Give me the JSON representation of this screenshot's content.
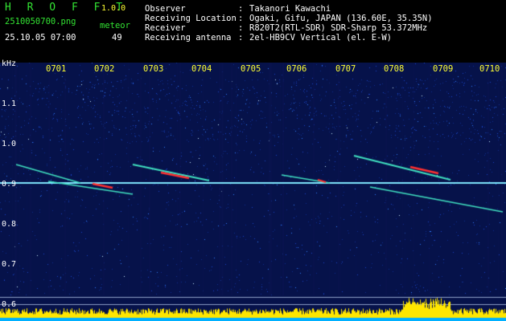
{
  "header": {
    "app_name": "H R O F F T",
    "version": "1.0.0",
    "filename": "2510050700.png",
    "datetime": "25.10.05 07:00",
    "meteor_label": "meteor",
    "meteor_count": "49",
    "info": [
      {
        "key": "Observer",
        "sep": ":",
        "value": "Takanori Kawachi"
      },
      {
        "key": "Receiving Location",
        "sep": ":",
        "value": "Ogaki, Gifu, JAPAN (136.60E, 35.35N)"
      },
      {
        "key": "Receiver",
        "sep": ":",
        "value": "R820T2(RTL-SDR) SDR-Sharp 53.372MHz"
      },
      {
        "key": "Receiving antenna",
        "sep": ":",
        "value": "2el-HB9CV Vertical (el. E-W)"
      }
    ]
  },
  "axis": {
    "unit": "kHz",
    "y_ticks": [
      "1.1",
      "1.0",
      "0.9",
      "0.8",
      "0.7",
      "0.6"
    ],
    "x_ticks": [
      "0701",
      "0702",
      "0703",
      "0704",
      "0705",
      "0706",
      "0707",
      "0708",
      "0709",
      "0710"
    ]
  },
  "colors": {
    "background": "#06124a",
    "carrier": "#7fe9ff",
    "meteor": "#40e0c0",
    "meteor_hot": "#ff3030",
    "histogram": "#ffe600",
    "histogram_base": "#00b0ff"
  }
}
